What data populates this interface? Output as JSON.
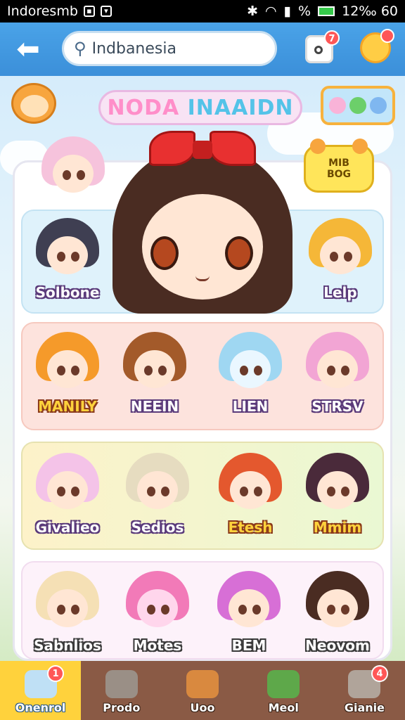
{
  "status_bar": {
    "carrier": "Indoresmb",
    "time": "12‰ 60",
    "battery_text": "%",
    "icons": [
      "image-icon",
      "shield-icon",
      "bluetooth-icon",
      "wifi-icon",
      "signal-icon",
      "battery-icon"
    ]
  },
  "header": {
    "back_icon": "back-arrow-icon",
    "search_value": "Indbanesia",
    "notification_badge": "7",
    "profile_icon": "profile-icon"
  },
  "title": {
    "part1": "NODA ",
    "part2": "INAAIDN"
  },
  "side_badge": {
    "line1": "MIB",
    "line2": "BOG"
  },
  "characters": {
    "row1": [
      {
        "name": "Solbone",
        "hair": "#3f3f52"
      },
      {
        "name": "Lelp",
        "hair": "#f5b738"
      }
    ],
    "row2": [
      {
        "name": "MANILY",
        "hair": "#f59a2a"
      },
      {
        "name": "NEEIN",
        "hair": "#a35a2a"
      },
      {
        "name": "LIEN",
        "hair": "#9fd7f2"
      },
      {
        "name": "STRSV",
        "hair": "#f2a5d4"
      }
    ],
    "row3": [
      {
        "name": "Givalieo",
        "hair": "#f4c3e8"
      },
      {
        "name": "Sedios",
        "hair": "#e6dcc0"
      },
      {
        "name": "Etesh",
        "hair": "#e4582e"
      },
      {
        "name": "Mmim",
        "hair": "#4a2a3a"
      }
    ],
    "row4": [
      {
        "name": "Sabnlios",
        "hair": "#f5e0b5"
      },
      {
        "name": "Motes",
        "hair": "#f27ab8"
      },
      {
        "name": "BEM",
        "hair": "#d76fd6"
      },
      {
        "name": "Neovom",
        "hair": "#4a2c22"
      }
    ],
    "top_left": {
      "hair": "#f6c3dc"
    }
  },
  "nav": [
    {
      "label": "Onenrol",
      "badge": "1",
      "icon": "ghost-icon"
    },
    {
      "label": "Prodo",
      "badge": "",
      "icon": "house-icon"
    },
    {
      "label": "Uoo",
      "badge": "",
      "icon": "home-icon"
    },
    {
      "label": "Meol",
      "badge": "",
      "icon": "heart-icon"
    },
    {
      "label": "Gianie",
      "badge": "4",
      "icon": "creature-icon"
    }
  ]
}
